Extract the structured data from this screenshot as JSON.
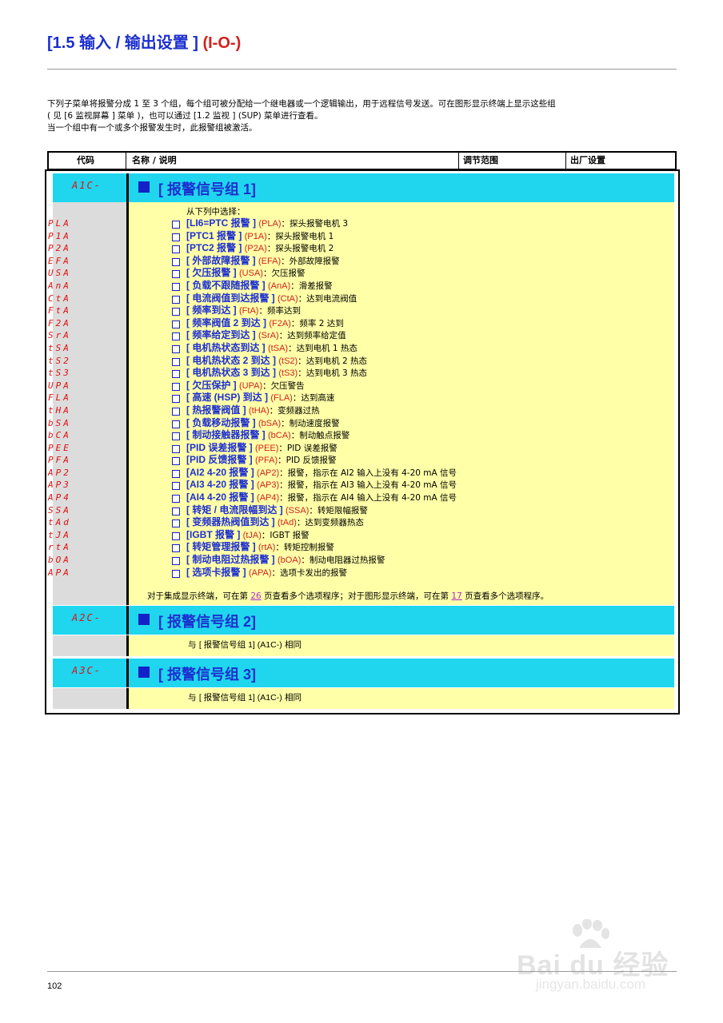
{
  "page": {
    "title_main": "[1.5 输入 / 输出设置 ]",
    "title_code": "(I-O-)",
    "intro_lines": [
      "下列子菜单将报警分成 1 至 3 个组，每个组可被分配给一个继电器或一个逻辑输出，用于远程信号发送。可在图形显示终端上显示这些组",
      "( 见 [6 监视屏幕 ] 菜单 )，也可以通过 [1.2 监视 ] (SUP) 菜单进行查看。",
      "当一个组中有一个或多个报警发生时，此报警组被激活。"
    ],
    "page_number": "102"
  },
  "table_header": {
    "code": "代码",
    "name": "名称 / 说明",
    "range": "调节范围",
    "factory": "出厂设置"
  },
  "groups": [
    {
      "code": "A1C-",
      "title": "[ 报警信号组 1]"
    },
    {
      "code": "A2C-",
      "title": "[ 报警信号组 2]",
      "same_prefix": "与 ",
      "same_ref": "[ 报警信号组 1] (A1C-)",
      "same_suffix": " 相同"
    },
    {
      "code": "A3C-",
      "title": "[ 报警信号组 3]",
      "same_prefix": "与 ",
      "same_ref": "[ 报警信号组 1] (A1C-)",
      "same_suffix": " 相同"
    }
  ],
  "list_lead": "从下列中选择：",
  "alarms": [
    {
      "disp": "PLA",
      "name": "[LI6=PTC 报警 ]",
      "code": "(PLA)",
      "desc": "：探头报警电机 3"
    },
    {
      "disp": "P1A",
      "name": "[PTC1 报警 ]",
      "code": "(P1A)",
      "desc": "：探头报警电机 1"
    },
    {
      "disp": "P2A",
      "name": "[PTC2 报警 ]",
      "code": "(P2A)",
      "desc": "：探头报警电机 2"
    },
    {
      "disp": "EFA",
      "name": "[ 外部故障报警 ]",
      "code": "(EFA)",
      "desc": "：外部故障报警"
    },
    {
      "disp": "USA",
      "name": "[ 欠压报警 ]",
      "code": "(USA)",
      "desc": "：欠压报警"
    },
    {
      "disp": "AnA",
      "name": "[ 负载不跟随报警 ]",
      "code": "(AnA)",
      "desc": "：滑差报警"
    },
    {
      "disp": "CtA",
      "name": "[ 电流阀值到达报警 ]",
      "code": "(CtA)",
      "desc": "：达到电流阀值"
    },
    {
      "disp": "FtA",
      "name": "[ 频率到达 ]",
      "code": "(FtA)",
      "desc": "：频率达到"
    },
    {
      "disp": "F2A",
      "name": "[ 频率阀值 2 到达 ]",
      "code": "(F2A)",
      "desc": "：频率 2 达到"
    },
    {
      "disp": "SrA",
      "name": "[ 频率给定到达 ]",
      "code": "(SrA)",
      "desc": "：达到频率给定值"
    },
    {
      "disp": "tSA",
      "name": "[ 电机热状态到达 ]",
      "code": "(tSA)",
      "desc": "：达到电机 1 热态"
    },
    {
      "disp": "tS2",
      "name": "[ 电机热状态 2 到达 ]",
      "code": "(tS2)",
      "desc": "：达到电机 2 热态"
    },
    {
      "disp": "tS3",
      "name": "[ 电机热状态 3 到达 ]",
      "code": "(tS3)",
      "desc": "：达到电机 3 热态"
    },
    {
      "disp": "UPA",
      "name": "[ 欠压保护 ]",
      "code": "(UPA)",
      "desc": "：欠压警告"
    },
    {
      "disp": "FLA",
      "name": "[ 高速 (HSP) 到达 ]",
      "code": "(FLA)",
      "desc": "：达到高速"
    },
    {
      "disp": "tHA",
      "name": "[ 热报警阀值 ]",
      "code": "(tHA)",
      "desc": "：变频器过热"
    },
    {
      "disp": "bSA",
      "name": "[ 负载移动报警 ]",
      "code": "(bSA)",
      "desc": "：制动速度报警"
    },
    {
      "disp": "bCA",
      "name": "[ 制动接触器报警 ]",
      "code": "(bCA)",
      "desc": "：制动触点报警"
    },
    {
      "disp": "PEE",
      "name": "[PID 误差报警 ]",
      "code": "(PEE)",
      "desc": "：PID 误差报警"
    },
    {
      "disp": "PFA",
      "name": "[PID 反馈报警 ]",
      "code": "(PFA)",
      "desc": "：PID 反馈报警"
    },
    {
      "disp": "AP2",
      "name": "[AI2 4-20 报警 ]",
      "code": "(AP2)",
      "desc": "：报警，指示在 AI2 输入上没有 4-20 mA 信号"
    },
    {
      "disp": "AP3",
      "name": "[AI3 4-20 报警 ]",
      "code": "(AP3)",
      "desc": "：报警，指示在 AI3 输入上没有 4-20 mA 信号"
    },
    {
      "disp": "AP4",
      "name": "[AI4 4-20 报警 ]",
      "code": "(AP4)",
      "desc": "：报警，指示在 AI4 输入上没有 4-20 mA 信号"
    },
    {
      "disp": "SSA",
      "name": "[ 转矩 / 电流限幅到达 ]",
      "code": "(SSA)",
      "desc": "：转矩限幅报警"
    },
    {
      "disp": "tAd",
      "name": "[ 变频器热阀值到达 ]",
      "code": "(tAd)",
      "desc": "：达到变频器热态"
    },
    {
      "disp": "tJA",
      "name": "[IGBT 报警 ]",
      "code": "(tJA)",
      "desc": "：IGBT 报警"
    },
    {
      "disp": "rtA",
      "name": "[ 转矩管理报警 ]",
      "code": "(rtA)",
      "desc": "：转矩控制报警"
    },
    {
      "disp": "bOA",
      "name": "[ 制动电阻过热报警 ]",
      "code": "(bOA)",
      "desc": "：制动电阻器过热报警"
    },
    {
      "disp": "APA",
      "name": "[ 选项卡报警 ]",
      "code": "(APA)",
      "desc": "：选项卡发出的报警"
    }
  ],
  "note": {
    "part1": "对于集成显示终端，可在第 ",
    "page1": "26",
    "part2": " 页查看多个选项程序；对于图形显示终端，可在第 ",
    "page2": "17",
    "part3": " 页查看多个选项程序。"
  },
  "watermark": {
    "brand": "Bai du 经验",
    "url": "jingyan.baidu.com"
  },
  "colors": {
    "title_blue": "#1d2fd0",
    "code_red": "#d4201c",
    "section_cyan": "#1fd6ee",
    "body_yellow": "#ffffa8",
    "code_grey": "#dcdcdc"
  }
}
